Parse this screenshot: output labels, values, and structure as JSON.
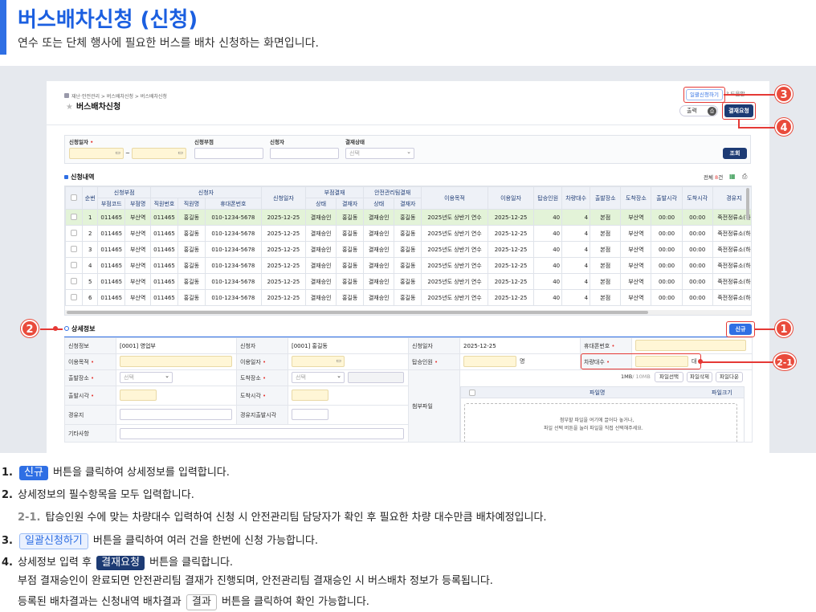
{
  "header": {
    "title": "버스배차신청 (신청)",
    "description": "연수 또는 단체 행사에 필요한 버스를 배차 신청하는 화면입니다."
  },
  "app": {
    "breadcrumb": "재난·안전관리 > 버스배차신청 > 버스배차신청",
    "page_title": "버스배차신청",
    "bulk_apply": "일괄신청하기",
    "help": "도움말",
    "print": "출력",
    "approval_request": "결재요청",
    "search": {
      "date_label": "신청일자",
      "dept_label": "신청부점",
      "applicant_label": "신청자",
      "status_label": "결재상태",
      "status_placeholder": "선택",
      "tilde": "~",
      "query_button": "조회"
    },
    "list": {
      "title": "신청내역",
      "total_prefix": "전체",
      "total_count": "8",
      "total_suffix": "건",
      "head1": [
        "순번",
        "신청부점",
        "신청자",
        "신청일자",
        "부점결재",
        "안전관리팀결재",
        "이용목적",
        "이용일자",
        "탑승인원",
        "차량대수",
        "출발장소",
        "도착장소",
        "출발시각",
        "도착시각",
        "경유지"
      ],
      "head2": [
        "부점코드",
        "부점명",
        "직원번호",
        "직원명",
        "휴대폰번호",
        "상태",
        "결재자",
        "상태",
        "결재자"
      ],
      "rows": [
        [
          "1",
          "011465",
          "부산역",
          "011465",
          "홍길동",
          "010-1234-5678",
          "2025-12-25",
          "결재승인",
          "홍길동",
          "결재승인",
          "홍길동",
          "2025년도 상반기 연수",
          "2025-12-25",
          "40",
          "4",
          "본점",
          "부산역",
          "00:00",
          "00:00",
          "죽전정류소(하"
        ],
        [
          "2",
          "011465",
          "부산역",
          "011465",
          "홍길동",
          "010-1234-5678",
          "2025-12-25",
          "결재승인",
          "홍길동",
          "결재승인",
          "홍길동",
          "2025년도 상반기 연수",
          "2025-12-25",
          "40",
          "4",
          "본점",
          "부산역",
          "00:00",
          "00:00",
          "죽전정류소(하"
        ],
        [
          "3",
          "011465",
          "부산역",
          "011465",
          "홍길동",
          "010-1234-5678",
          "2025-12-25",
          "결재승인",
          "홍길동",
          "결재승인",
          "홍길동",
          "2025년도 상반기 연수",
          "2025-12-25",
          "40",
          "4",
          "본점",
          "부산역",
          "00:00",
          "00:00",
          "죽전정류소(하"
        ],
        [
          "4",
          "011465",
          "부산역",
          "011465",
          "홍길동",
          "010-1234-5678",
          "2025-12-25",
          "결재승인",
          "홍길동",
          "결재승인",
          "홍길동",
          "2025년도 상반기 연수",
          "2025-12-25",
          "40",
          "4",
          "본점",
          "부산역",
          "00:00",
          "00:00",
          "죽전정류소(하"
        ],
        [
          "5",
          "011465",
          "부산역",
          "011465",
          "홍길동",
          "010-1234-5678",
          "2025-12-25",
          "결재승인",
          "홍길동",
          "결재승인",
          "홍길동",
          "2025년도 상반기 연수",
          "2025-12-25",
          "40",
          "4",
          "본점",
          "부산역",
          "00:00",
          "00:00",
          "죽전정류소(하"
        ],
        [
          "6",
          "011465",
          "부산역",
          "011465",
          "홍길동",
          "010-1234-5678",
          "2025-12-25",
          "결재승인",
          "홍길동",
          "결재승인",
          "홍길동",
          "2025년도 상반기 연수",
          "2025-12-25",
          "40",
          "4",
          "본점",
          "부산역",
          "00:00",
          "00:00",
          "죽전정류소(하"
        ]
      ]
    },
    "detail": {
      "title": "상세정보",
      "new_button": "신규",
      "dept_info_label": "신청정보",
      "dept_info_value": "[0001] 영업부",
      "applicant_label": "신청자",
      "applicant_value": "[0001] 홍길동",
      "apply_date_label": "신청일자",
      "apply_date_value": "2025-12-25",
      "phone_label": "휴대폰번호",
      "purpose_label": "이용목적",
      "use_date_label": "이용일자",
      "passengers_label": "탑승인원",
      "passengers_unit": "명",
      "vehicles_label": "차량대수",
      "vehicles_unit": "대",
      "depart_label": "출발장소",
      "arrive_label": "도착장소",
      "select_placeholder": "선택",
      "depart_time_label": "출발시각",
      "arrive_time_label": "도착시각",
      "waypoint_label": "경유지",
      "waypoint_time_label": "경유지출발시각",
      "other_label": "기타사항",
      "attach_label": "첨부파일",
      "file_size": "1MB",
      "file_limit": "/ 10MB",
      "file_select": "파일선택",
      "file_delete": "파일삭제",
      "file_download": "파일다운",
      "file_name_col": "파일명",
      "file_size_col": "파일크기",
      "drop_hint1": "첨부할 파일을 여기에 끌어다 놓거나,",
      "drop_hint2": "파일 선택 버튼을 눌러 파일을 직접 선택해주세요."
    }
  },
  "callouts": [
    "1",
    "2",
    "2-1",
    "3",
    "4"
  ],
  "steps": {
    "s1_num": "1.",
    "s1_tag": "신규",
    "s1_text": "버튼을 클릭하여 상세정보를 입력합니다.",
    "s2_num": "2.",
    "s2_text": "상세정보의 필수항목을 모두 입력합니다.",
    "s21_num": "2-1.",
    "s21_text": "탑승인원 수에 맞는 차량대수 입력하여 신청 시 안전관리팀 담당자가 확인 후 필요한 차량 대수만큼 배차예정입니다.",
    "s3_num": "3.",
    "s3_tag": "일괄신청하기",
    "s3_text": "버튼을 클릭하여 여러 건을 한번에 신청 가능합니다.",
    "s4_num": "4.",
    "s4_pre": "상세정보 입력 후",
    "s4_tag": "결재요청",
    "s4_text": "버튼을 클릭합니다.",
    "s4_line2": "부점 결재승인이 완료되면 안전관리팀 결재가 진행되며, 안전관리팀 결재승인 시 버스배차 정보가 등록됩니다.",
    "s4_line3_pre": "등록된 배차결과는 신청내역 배차결과",
    "s4_line3_tag": "결과",
    "s4_line3_post": "버튼을 클릭하여 확인 가능합니다."
  },
  "colors": {
    "accent": "#2f6fe4",
    "dark": "#1d3b74",
    "callout": "#e94b3c",
    "selected_row": "#e3f3d8",
    "required": "#e53935"
  }
}
